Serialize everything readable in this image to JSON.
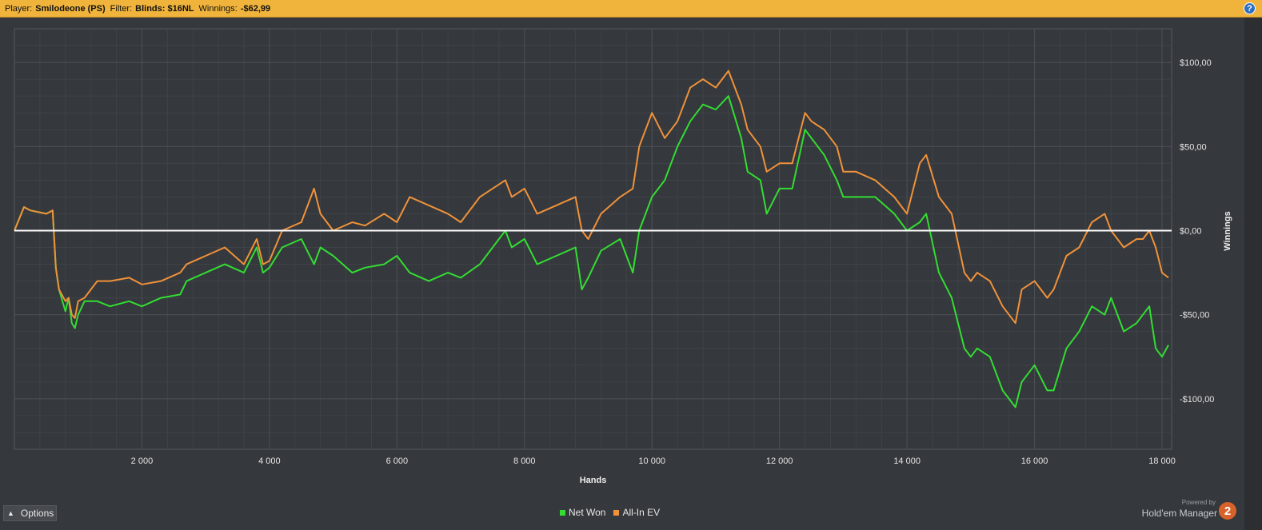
{
  "header": {
    "player_label": "Player:",
    "player_value": "Smilodeone (PS)",
    "filter_label": "Filter:",
    "filter_value": "Blinds: $16NL",
    "winnings_label": "Winnings:",
    "winnings_value": "-$62,99",
    "help_icon": "?"
  },
  "footer": {
    "options_label": "Options",
    "powered_by": "Powered by",
    "brand": "Hold'em Manager",
    "logo_text": "2"
  },
  "colors": {
    "net_won": "#33dd33",
    "all_in_ev": "#f0923a",
    "zero_line": "#ffffff",
    "grid": "#4c5055",
    "plot_bg": "#35383c"
  },
  "chart_data": {
    "type": "line",
    "xlabel": "Hands",
    "ylabel": "Winnings",
    "xlim": [
      0,
      18150
    ],
    "ylim": [
      -130,
      120
    ],
    "x_ticks": [
      {
        "value": 2000,
        "label": "2 000"
      },
      {
        "value": 4000,
        "label": "4 000"
      },
      {
        "value": 6000,
        "label": "6 000"
      },
      {
        "value": 8000,
        "label": "8 000"
      },
      {
        "value": 10000,
        "label": "10 000"
      },
      {
        "value": 12000,
        "label": "12 000"
      },
      {
        "value": 14000,
        "label": "14 000"
      },
      {
        "value": 16000,
        "label": "16 000"
      },
      {
        "value": 18000,
        "label": "18 000"
      }
    ],
    "y_ticks": [
      {
        "value": 100,
        "label": "$100,00"
      },
      {
        "value": 50,
        "label": "$50,00"
      },
      {
        "value": 0,
        "label": "$0,00"
      },
      {
        "value": -50,
        "label": "-$50,00"
      },
      {
        "value": -100,
        "label": "-$100,00"
      }
    ],
    "grid": true,
    "legend_position": "bottom-center",
    "series": [
      {
        "name": "Net Won",
        "color": "#33dd33",
        "x": [
          0,
          150,
          250,
          500,
          600,
          650,
          700,
          800,
          850,
          900,
          950,
          1000,
          1100,
          1300,
          1500,
          1800,
          2000,
          2300,
          2600,
          2700,
          3000,
          3300,
          3600,
          3800,
          3900,
          4000,
          4200,
          4500,
          4700,
          4800,
          5000,
          5300,
          5500,
          5800,
          6000,
          6200,
          6500,
          6800,
          7000,
          7300,
          7700,
          7800,
          8000,
          8200,
          8500,
          8800,
          8900,
          9000,
          9200,
          9500,
          9700,
          9800,
          10000,
          10200,
          10400,
          10600,
          10800,
          11000,
          11200,
          11400,
          11500,
          11700,
          11800,
          12000,
          12200,
          12400,
          12500,
          12700,
          12900,
          13000,
          13200,
          13500,
          13800,
          14000,
          14200,
          14300,
          14500,
          14700,
          14900,
          15000,
          15100,
          15300,
          15500,
          15700,
          15800,
          16000,
          16200,
          16300,
          16500,
          16700,
          16900,
          17100,
          17200,
          17400,
          17600,
          17700,
          17800,
          17900,
          18000,
          18100
        ],
        "y": [
          0,
          14,
          12,
          10,
          12,
          -22,
          -35,
          -48,
          -40,
          -55,
          -58,
          -50,
          -42,
          -42,
          -45,
          -42,
          -45,
          -40,
          -38,
          -30,
          -25,
          -20,
          -25,
          -10,
          -25,
          -22,
          -10,
          -5,
          -20,
          -10,
          -15,
          -25,
          -22,
          -20,
          -15,
          -25,
          -30,
          -25,
          -28,
          -20,
          0,
          -10,
          -5,
          -20,
          -15,
          -10,
          -35,
          -28,
          -12,
          -5,
          -25,
          0,
          20,
          30,
          50,
          65,
          75,
          72,
          80,
          55,
          35,
          30,
          10,
          25,
          25,
          60,
          55,
          45,
          30,
          20,
          20,
          20,
          10,
          0,
          5,
          10,
          -25,
          -40,
          -70,
          -75,
          -70,
          -75,
          -95,
          -105,
          -90,
          -80,
          -95,
          -95,
          -70,
          -60,
          -45,
          -50,
          -40,
          -60,
          -55,
          -50,
          -45,
          -70,
          -75,
          -68
        ]
      },
      {
        "name": "All-In EV",
        "color": "#f0923a",
        "x": [
          0,
          150,
          250,
          500,
          600,
          650,
          700,
          800,
          850,
          900,
          950,
          1000,
          1100,
          1300,
          1500,
          1800,
          2000,
          2300,
          2600,
          2700,
          3000,
          3300,
          3600,
          3800,
          3900,
          4000,
          4200,
          4500,
          4700,
          4800,
          5000,
          5300,
          5500,
          5800,
          6000,
          6200,
          6500,
          6800,
          7000,
          7300,
          7700,
          7800,
          8000,
          8200,
          8500,
          8800,
          8900,
          9000,
          9200,
          9500,
          9700,
          9800,
          10000,
          10200,
          10400,
          10600,
          10800,
          11000,
          11200,
          11400,
          11500,
          11700,
          11800,
          12000,
          12200,
          12400,
          12500,
          12700,
          12900,
          13000,
          13200,
          13500,
          13800,
          14000,
          14200,
          14300,
          14500,
          14700,
          14900,
          15000,
          15100,
          15300,
          15500,
          15700,
          15800,
          16000,
          16200,
          16300,
          16500,
          16700,
          16900,
          17100,
          17200,
          17400,
          17600,
          17700,
          17800,
          17900,
          18000,
          18100
        ],
        "y": [
          0,
          14,
          12,
          10,
          12,
          -22,
          -35,
          -42,
          -40,
          -50,
          -52,
          -42,
          -40,
          -30,
          -30,
          -28,
          -32,
          -30,
          -25,
          -20,
          -15,
          -10,
          -20,
          -5,
          -20,
          -18,
          0,
          5,
          25,
          10,
          0,
          5,
          3,
          10,
          5,
          20,
          15,
          10,
          5,
          20,
          30,
          20,
          25,
          10,
          15,
          20,
          0,
          -5,
          10,
          20,
          25,
          50,
          70,
          55,
          65,
          85,
          90,
          85,
          95,
          75,
          60,
          50,
          35,
          40,
          40,
          70,
          65,
          60,
          50,
          35,
          35,
          30,
          20,
          10,
          40,
          45,
          20,
          10,
          -25,
          -30,
          -25,
          -30,
          -45,
          -55,
          -35,
          -30,
          -40,
          -35,
          -15,
          -10,
          5,
          10,
          0,
          -10,
          -5,
          -5,
          0,
          -10,
          -25,
          -28
        ]
      }
    ]
  }
}
